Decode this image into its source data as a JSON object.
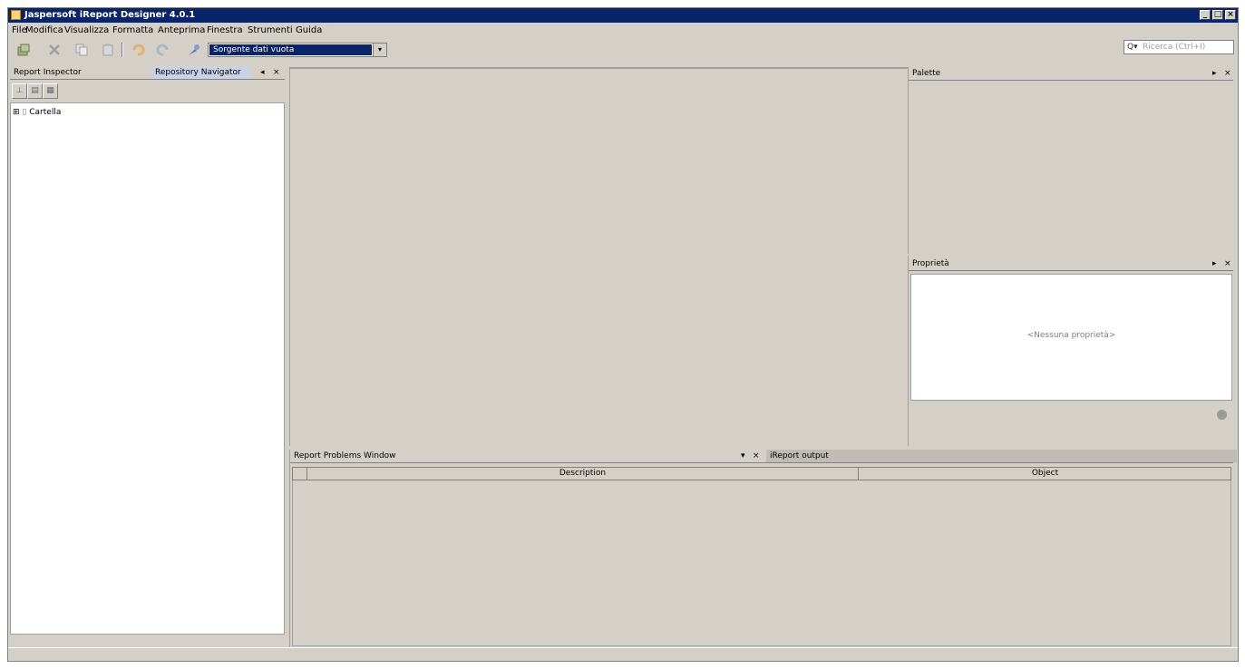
{
  "window": {
    "title": "Jaspersoft iReport Designer 4.0.1"
  },
  "menu": [
    "File",
    "Modifica",
    "Visualizza",
    "Formatta",
    "Anteprima",
    "Finestra",
    "Strumenti",
    "Guida"
  ],
  "toolbar": {
    "icons": [
      "open-icon",
      "cut-icon",
      "copy-icon",
      "paste-icon",
      "undo-icon",
      "redo-icon",
      "datasource-icon"
    ],
    "datasource_value": "Sorgente dati vuota",
    "search_placeholder": "Ricerca (Ctrl+I)"
  },
  "left_panel": {
    "tabs": [
      "Report Inspector",
      "Repository Navigator"
    ],
    "tree_items": [
      "Cartella"
    ]
  },
  "palette": {
    "title": "Palette"
  },
  "properties": {
    "title": "Proprietà",
    "empty_text": "<Nessuna proprietà>"
  },
  "bottom_panel": {
    "tabs": [
      "Report Problems Window",
      "iReport output"
    ],
    "columns": [
      "Description",
      "Object"
    ]
  },
  "colors": {
    "title_bar": "#0a246a",
    "chrome": "#d4d0c8",
    "active_tab": "#c9d3e6"
  }
}
